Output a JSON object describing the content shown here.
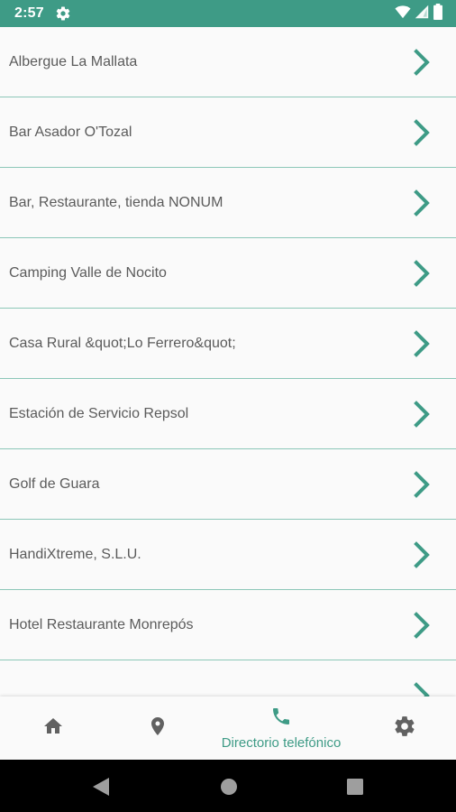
{
  "status_bar": {
    "time": "2:57",
    "icons": [
      "gear-icon",
      "wifi-icon",
      "signal-icon",
      "battery-icon"
    ]
  },
  "directory": {
    "items": [
      "Albergue La Mallata",
      "Bar Asador O'Tozal",
      "Bar, Restaurante, tienda NONUM",
      "Camping Valle de Nocito",
      "Casa Rural &quot;Lo Ferrero&quot;",
      "Estación de Servicio Repsol",
      "Golf de Guara",
      "HandiXtreme, S.L.U.",
      "Hotel Restaurante Monrepós"
    ],
    "row_icon": "chevron-right-icon",
    "divider_color": "#8cc7b8"
  },
  "bottom_nav": {
    "items": [
      {
        "icon": "home-icon"
      },
      {
        "icon": "location-pin-icon"
      },
      {
        "icon": "phone-icon",
        "label": "Directorio telefónico",
        "active": true
      },
      {
        "icon": "settings-icon"
      }
    ]
  },
  "colors": {
    "accent": "#3e9b86",
    "text": "#5b5b5b",
    "inactive_icon": "#616161",
    "background": "#fafafa"
  },
  "system_nav": {
    "icons": [
      "back-icon",
      "home-circle-icon",
      "recents-icon"
    ]
  }
}
